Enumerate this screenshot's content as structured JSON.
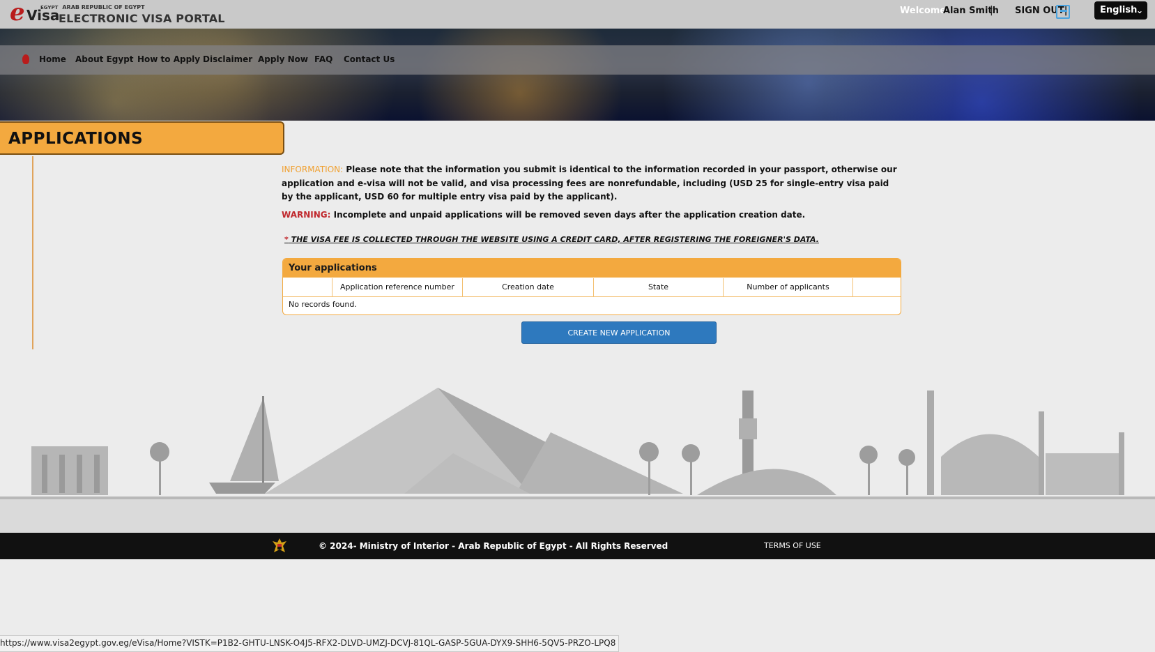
{
  "header": {
    "logo_e": "e",
    "logo_visa": "Visa",
    "logo_country_small": "EGYPT",
    "logo_republic": "ARAB REPUBLIC OF EGYPT",
    "portal_name": "ELECTRONIC VISA PORTAL",
    "welcome_label": "Welcome",
    "user_name": "Alan Smith",
    "separator": "|",
    "sign_out": "SIGN OUT|",
    "language": "English"
  },
  "nav": {
    "items": [
      "Home",
      "About Egypt",
      "How to Apply",
      "Disclaimer",
      "Apply Now",
      "FAQ",
      "Contact Us"
    ]
  },
  "page": {
    "title": "APPLICATIONS",
    "information_label": "INFORMATION:",
    "information_text": "Please note that the information you submit is identical to the information recorded in your passport, otherwise our application and e-visa will not be valid, and visa processing fees are nonrefundable, including (USD 25 for single-entry visa paid by the applicant, USD 60 for multiple entry visa paid by the applicant).",
    "warning_label": "WARNING:",
    "warning_text": "Incomplete and unpaid applications will be removed seven days after the application creation date.",
    "fee_star": "*",
    "fee_note": "THE VISA FEE IS COLLECTED THROUGH THE WEBSITE USING A CREDIT CARD, AFTER REGISTERING THE FOREIGNER'S DATA."
  },
  "applications_table": {
    "title": "Your applications",
    "columns": [
      "",
      "Application reference number",
      "Creation date",
      "State",
      "Number of applicants",
      ""
    ],
    "empty_message": "No records found."
  },
  "create_button": "CREATE NEW APPLICATION",
  "footer": {
    "copyright": "© 2024- Ministry of Interior - Arab Republic of Egypt - All Rights Reserved",
    "terms": "TERMS OF USE"
  },
  "status_url": "https://www.visa2egypt.gov.eg/eVisa/Home?VISTK=P1B2-GHTU-LNSK-O4J5-RFX2-DLVD-UMZJ-DCVJ-81QL-GASP-5GUA-DYX9-SHH6-5QV5-PRZO-LPQ8",
  "colors": {
    "accent_orange": "#f3a93f",
    "warning_red": "#c0282d",
    "button_blue": "#2e79be",
    "footer_black": "#111111"
  }
}
